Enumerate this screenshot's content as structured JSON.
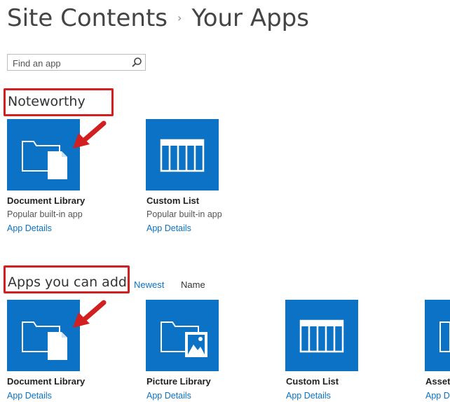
{
  "header": {
    "title": "Site Contents",
    "separator": "›",
    "subtitle": "Your Apps"
  },
  "search": {
    "placeholder": "Find an app",
    "icon": "search-icon"
  },
  "noteworthy": {
    "heading": "Noteworthy",
    "apps": [
      {
        "name": "Document Library",
        "description": "Popular built-in app",
        "link": "App Details",
        "icon": "document-library-icon"
      },
      {
        "name": "Custom List",
        "description": "Popular built-in app",
        "link": "App Details",
        "icon": "custom-list-icon"
      }
    ]
  },
  "apps_you_can_add": {
    "heading": "Apps you can add",
    "sort": {
      "newest": "Newest",
      "name": "Name"
    },
    "apps": [
      {
        "name": "Document Library",
        "link": "App Details",
        "icon": "document-library-icon"
      },
      {
        "name": "Picture Library",
        "link": "App Details",
        "icon": "picture-library-icon"
      },
      {
        "name": "Custom List",
        "link": "App Details",
        "icon": "custom-list-icon"
      },
      {
        "name": "Asset",
        "link": "App D",
        "icon": "asset-library-icon"
      }
    ]
  },
  "colors": {
    "tile": "#0b72c6",
    "link": "#0b72c6",
    "highlight": "#d21f1f"
  }
}
